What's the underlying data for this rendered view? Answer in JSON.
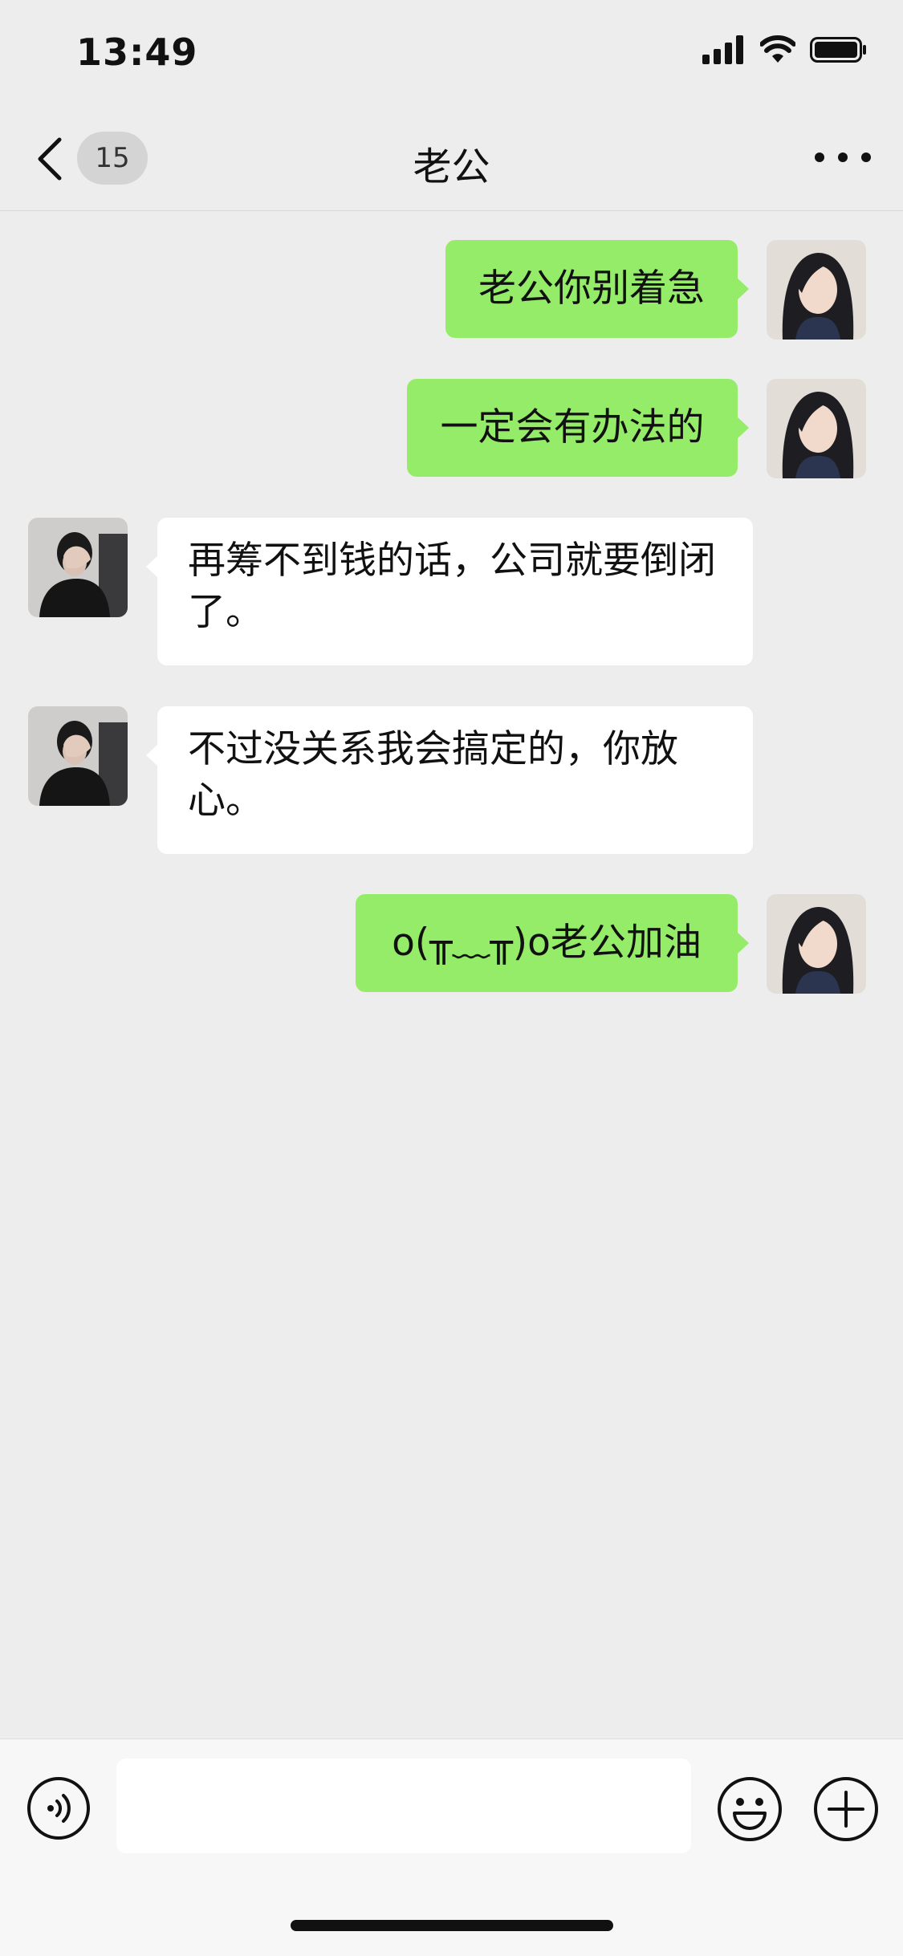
{
  "status_bar": {
    "time": "13:49"
  },
  "nav": {
    "unread_count": "15",
    "title": "老公"
  },
  "messages": [
    {
      "direction": "sent",
      "sender": "me",
      "text": "老公你别着急"
    },
    {
      "direction": "sent",
      "sender": "me",
      "text": "一定会有办法的"
    },
    {
      "direction": "received",
      "sender": "husband",
      "text": "再筹不到钱的话，公司就要倒闭了。"
    },
    {
      "direction": "received",
      "sender": "husband",
      "text": "不过没关系我会搞定的，你放心。"
    },
    {
      "direction": "sent",
      "sender": "me",
      "text": "o(╥﹏╥)o老公加油"
    }
  ],
  "input_bar": {
    "value": "",
    "icons": [
      "voice-icon",
      "emoji-icon",
      "plus-icon"
    ]
  },
  "colors": {
    "sent_bubble": "#95ec69",
    "received_bubble": "#ffffff",
    "background": "#ededed"
  }
}
